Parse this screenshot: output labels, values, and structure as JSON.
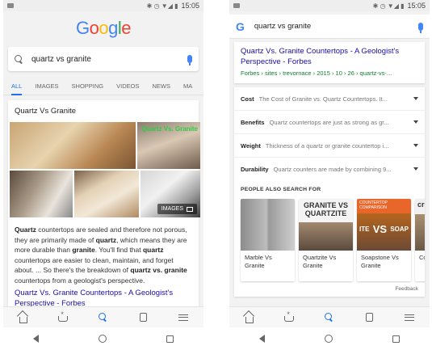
{
  "status": {
    "time": "15:05",
    "icons": "✱ ◷ ▼◢ ▮"
  },
  "left": {
    "logo_letters": [
      "G",
      "o",
      "o",
      "g",
      "l",
      "e"
    ],
    "search_query": "quartz vs granite",
    "tabs": [
      "ALL",
      "IMAGES",
      "SHOPPING",
      "VIDEOS",
      "NEWS",
      "MA"
    ],
    "card_title": "Quartz Vs Granite",
    "gallery_overlay": "Quartz Vs. Granite",
    "images_chip": "IMAGES",
    "snippet_parts": {
      "p1b": "Quartz",
      "p1": " countertops are sealed and therefore not porous, they are primarily made of ",
      "p2b": "quartz",
      "p2": ", which means they are more durable than ",
      "p3b": "granite",
      "p3": ". You'll find that ",
      "p4b": "quartz",
      "p4": " countertops are easier to clean, maintain, and forget about. ... So there's the breakdown of ",
      "p5b": "quartz vs. granite",
      "p5": " countertops from a geologist's perspective."
    },
    "link_title": "Quartz Vs. Granite Countertops - A Geologist's Perspective - Forbes"
  },
  "right": {
    "g_letter": "G",
    "search_query": "quartz vs granite",
    "link_title": "Quartz Vs. Granite Countertops - A Geologist's Perspective - Forbes",
    "url": "Forbes › sites › trevornace › 2015 › 10 › 26 › quartz-vs-...",
    "rows": [
      {
        "key": "Cost",
        "value": "The Cost of Granite vs. Quartz Countertops. It..."
      },
      {
        "key": "Benefits",
        "value": "Quartz countertops are just as strong as gr..."
      },
      {
        "key": "Weight",
        "value": "Thickness of a quartz or granite countertop i..."
      },
      {
        "key": "Durability",
        "value": "Quartz counters are made by combining 9..."
      }
    ],
    "people_also_search": "PEOPLE ALSO SEARCH FOR",
    "related": [
      {
        "label": "Marble Vs Granite"
      },
      {
        "label": "Quartzite Vs Granite"
      },
      {
        "label": "Soapstone Vs Granite"
      },
      {
        "label": "Co Gra"
      }
    ],
    "thumb_texts": {
      "quartzite_top": "GRANITE VS",
      "quartzite_bot": "QUARTZITE",
      "soap_header": "COUNTERTOP COMPARISON",
      "soap_l": "ITE",
      "soap_vs": "VS",
      "soap_r": "SOAP",
      "cre": "cre"
    },
    "feedback": "Feedback"
  },
  "colors": {
    "accent": "#1a73e8",
    "link": "#1a0dab",
    "url_green": "#0d7d32"
  }
}
